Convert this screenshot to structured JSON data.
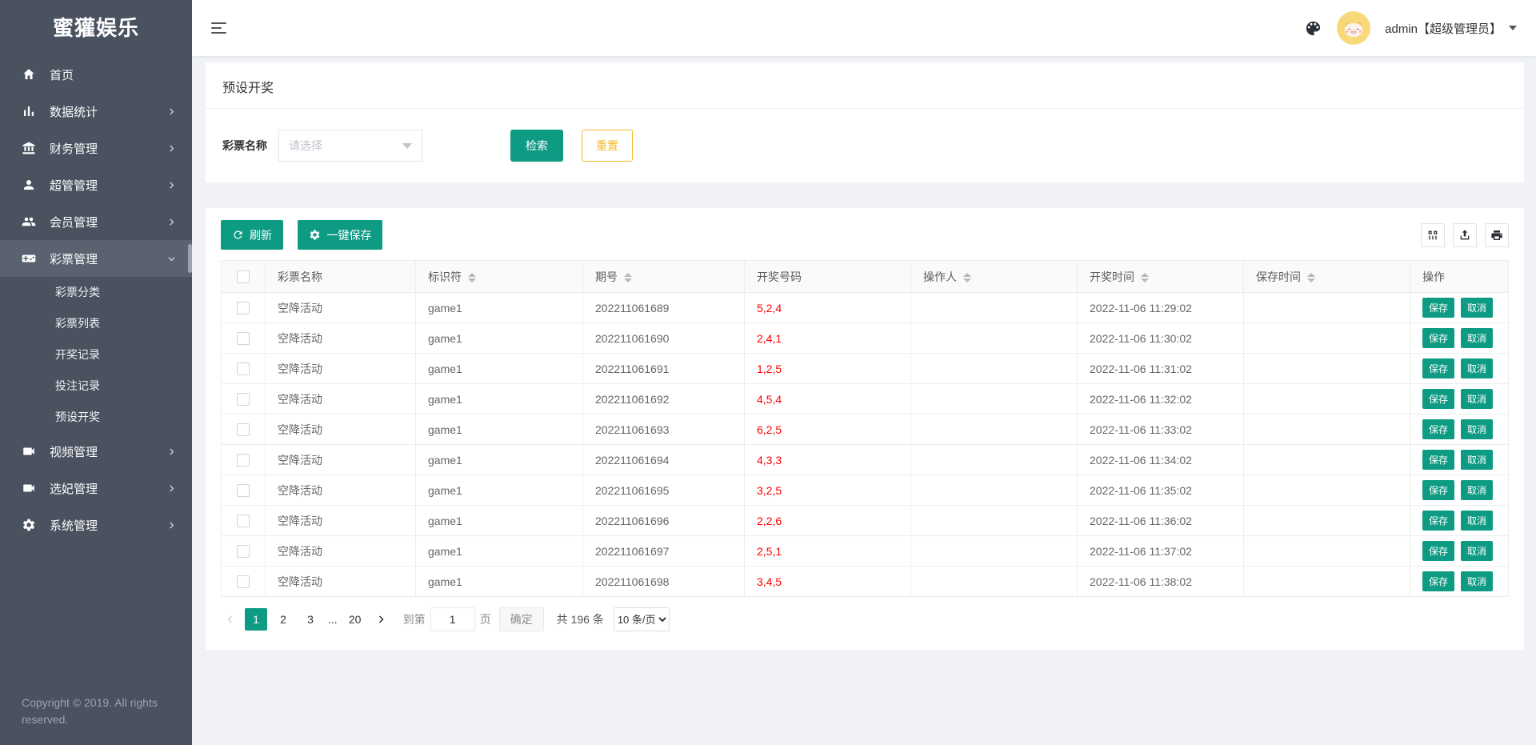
{
  "brand": "蜜獾娱乐",
  "colors": {
    "accent": "#0e9b83",
    "warning": "#f7b824",
    "number_red": "#ff0000",
    "sidebar_bg": "#4a5260",
    "sidebar_active": "#5a6270"
  },
  "header": {
    "username": "admin【超级管理员】"
  },
  "sidebar": {
    "items": [
      {
        "id": "home",
        "label": "首页",
        "icon": "home"
      },
      {
        "id": "stats",
        "label": "数据统计",
        "icon": "chart",
        "chevron": "right"
      },
      {
        "id": "finance",
        "label": "财务管理",
        "icon": "bank",
        "chevron": "right"
      },
      {
        "id": "super-admin",
        "label": "超管管理",
        "icon": "user",
        "chevron": "right"
      },
      {
        "id": "members",
        "label": "会员管理",
        "icon": "users",
        "chevron": "right"
      },
      {
        "id": "lottery",
        "label": "彩票管理",
        "icon": "gamepad",
        "chevron": "down",
        "active": true,
        "submenu": [
          "彩票分类",
          "彩票列表",
          "开奖记录",
          "投注记录",
          "预设开奖"
        ]
      },
      {
        "id": "video",
        "label": "视频管理",
        "icon": "video",
        "chevron": "right"
      },
      {
        "id": "concubine",
        "label": "选妃管理",
        "icon": "video",
        "chevron": "right"
      },
      {
        "id": "system",
        "label": "系统管理",
        "icon": "gear",
        "chevron": "right"
      }
    ],
    "copyright": "Copyright © 2019. All rights reserved."
  },
  "page": {
    "title": "预设开奖"
  },
  "filter": {
    "label": "彩票名称",
    "placeholder": "请选择",
    "search_label": "检索",
    "reset_label": "重置"
  },
  "toolbar": {
    "refresh_label": "刷新",
    "save_all_label": "一键保存",
    "right_icons": [
      "cols",
      "export",
      "print"
    ]
  },
  "table": {
    "columns": [
      {
        "label": "彩票名称",
        "sortable": false
      },
      {
        "label": "标识符",
        "sortable": true
      },
      {
        "label": "期号",
        "sortable": true
      },
      {
        "label": "开奖号码",
        "sortable": false
      },
      {
        "label": "操作人",
        "sortable": true
      },
      {
        "label": "开奖时间",
        "sortable": true
      },
      {
        "label": "保存时间",
        "sortable": true
      },
      {
        "label": "操作",
        "sortable": false
      }
    ],
    "actions": {
      "save": "保存",
      "cancel": "取消"
    },
    "rows": [
      {
        "name": "空降活动",
        "code": "game1",
        "issue": "202211061689",
        "numbers": "5,2,4",
        "operator": "",
        "draw_time": "2022-11-06 11:29:02",
        "save_time": ""
      },
      {
        "name": "空降活动",
        "code": "game1",
        "issue": "202211061690",
        "numbers": "2,4,1",
        "operator": "",
        "draw_time": "2022-11-06 11:30:02",
        "save_time": ""
      },
      {
        "name": "空降活动",
        "code": "game1",
        "issue": "202211061691",
        "numbers": "1,2,5",
        "operator": "",
        "draw_time": "2022-11-06 11:31:02",
        "save_time": ""
      },
      {
        "name": "空降活动",
        "code": "game1",
        "issue": "202211061692",
        "numbers": "4,5,4",
        "operator": "",
        "draw_time": "2022-11-06 11:32:02",
        "save_time": ""
      },
      {
        "name": "空降活动",
        "code": "game1",
        "issue": "202211061693",
        "numbers": "6,2,5",
        "operator": "",
        "draw_time": "2022-11-06 11:33:02",
        "save_time": ""
      },
      {
        "name": "空降活动",
        "code": "game1",
        "issue": "202211061694",
        "numbers": "4,3,3",
        "operator": "",
        "draw_time": "2022-11-06 11:34:02",
        "save_time": ""
      },
      {
        "name": "空降活动",
        "code": "game1",
        "issue": "202211061695",
        "numbers": "3,2,5",
        "operator": "",
        "draw_time": "2022-11-06 11:35:02",
        "save_time": ""
      },
      {
        "name": "空降活动",
        "code": "game1",
        "issue": "202211061696",
        "numbers": "2,2,6",
        "operator": "",
        "draw_time": "2022-11-06 11:36:02",
        "save_time": ""
      },
      {
        "name": "空降活动",
        "code": "game1",
        "issue": "202211061697",
        "numbers": "2,5,1",
        "operator": "",
        "draw_time": "2022-11-06 11:37:02",
        "save_time": ""
      },
      {
        "name": "空降活动",
        "code": "game1",
        "issue": "202211061698",
        "numbers": "3,4,5",
        "operator": "",
        "draw_time": "2022-11-06 11:38:02",
        "save_time": ""
      }
    ]
  },
  "pagination": {
    "pages": [
      "1",
      "2",
      "3",
      "...",
      "20"
    ],
    "current": "1",
    "goto_label": "到第",
    "goto_value": "1",
    "page_label": "页",
    "confirm_label": "确定",
    "total_label": "共 196 条",
    "page_size_label": "10 条/页"
  }
}
